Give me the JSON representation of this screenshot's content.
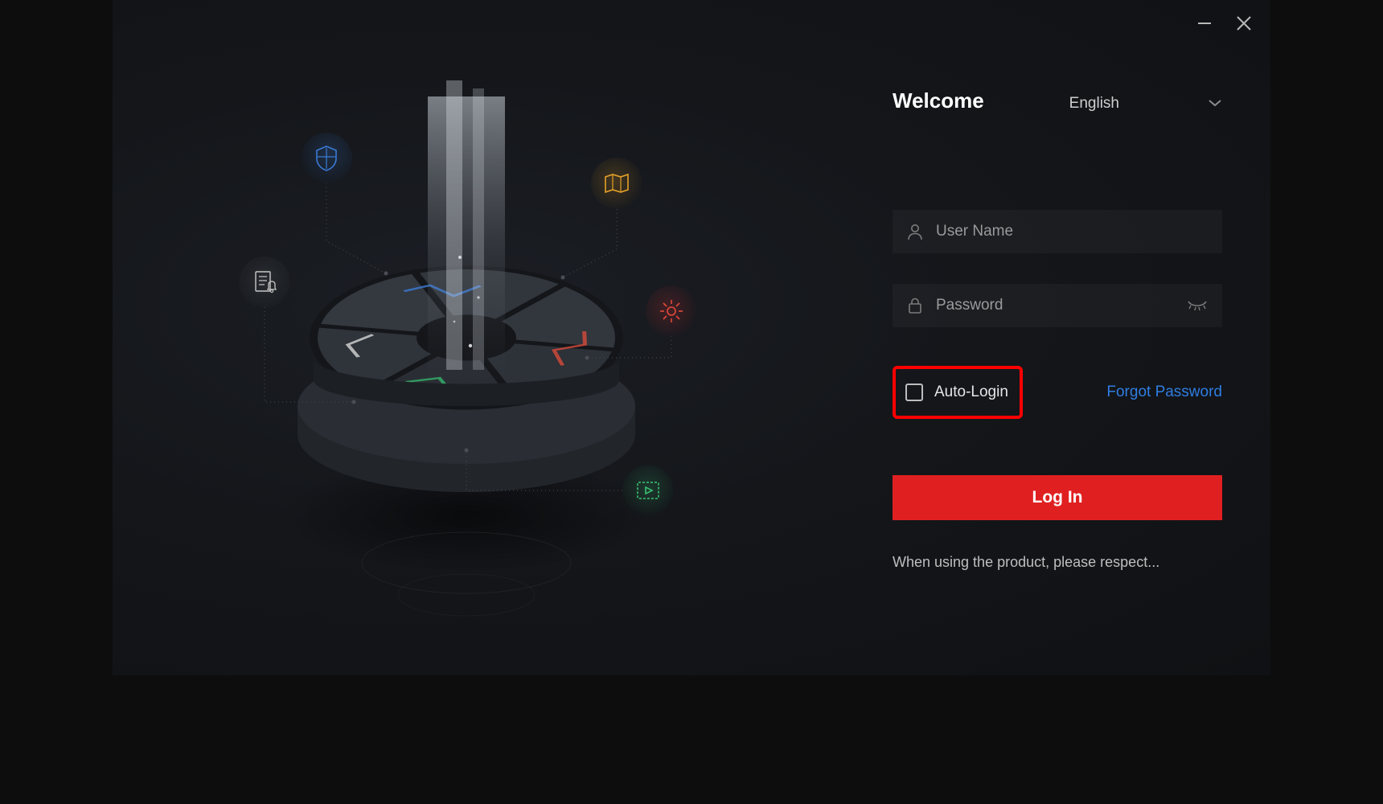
{
  "header": {
    "welcome": "Welcome",
    "language": "English"
  },
  "fields": {
    "username_placeholder": "User Name",
    "password_placeholder": "Password"
  },
  "options": {
    "auto_login_label": "Auto-Login",
    "forgot_password": "Forgot Password"
  },
  "actions": {
    "login_label": "Log In"
  },
  "footnote": "When using the product, please respect...",
  "icons": {
    "shield": "shield-icon",
    "map": "map-icon",
    "document_bell": "document-bell-icon",
    "gear": "gear-icon",
    "play": "play-icon"
  },
  "colors": {
    "accent_red": "#e02020",
    "link_blue": "#2f7de1",
    "highlight_red": "#ff0000",
    "orb_blue": "#3a7bd5",
    "orb_amber": "#e6a028",
    "orb_red": "#dc3232",
    "orb_green": "#3cc878",
    "orb_grey": "#c8c8c8"
  }
}
